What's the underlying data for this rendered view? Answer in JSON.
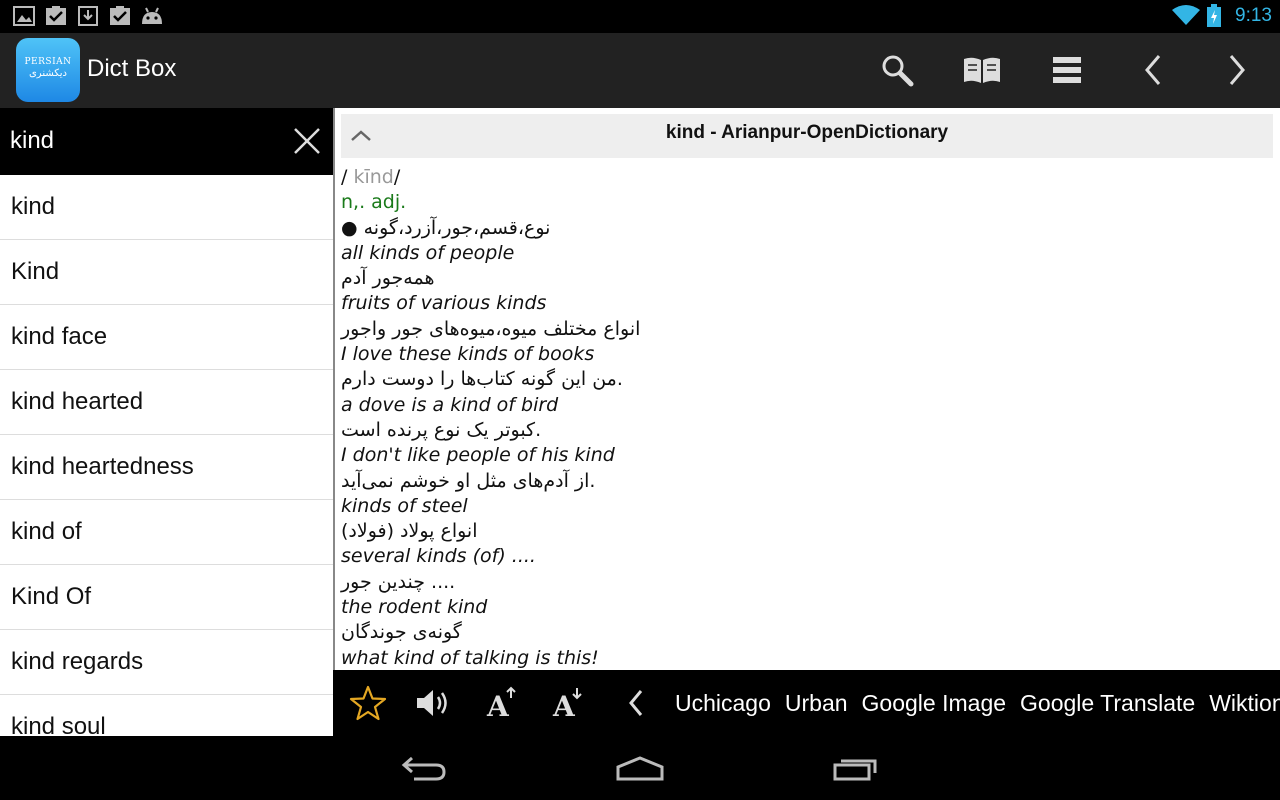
{
  "status_bar": {
    "time": "9:13",
    "left_icons": [
      "image-notification-icon",
      "task-done-icon",
      "download-icon",
      "task-done-icon",
      "android-debug-icon"
    ],
    "right_icons": [
      "wifi-icon",
      "battery-charging-icon"
    ],
    "accent_color": "#33b5e5"
  },
  "action_bar": {
    "app_logo_line1": "PERSIAN",
    "app_logo_line2": "دیکشنری",
    "app_title": "Dict Box",
    "buttons": [
      "search-icon",
      "book-icon",
      "list-icon",
      "chevron-left-icon",
      "chevron-right-icon"
    ]
  },
  "search": {
    "value": "kind"
  },
  "word_list": [
    "kind",
    "Kind",
    "kind face",
    "kind hearted",
    "kind heartedness",
    "kind of",
    "Kind Of",
    "kind regards",
    "kind soul"
  ],
  "definition": {
    "title": "kind - Arianpur-OpenDictionary",
    "pronunciation_open": "/ ",
    "pronunciation": "kīnd",
    "pronunciation_close": "/",
    "part_of_speech": "n,. adj.",
    "meaning": "● نوع،قسم،جور،آزرد،گونه",
    "examples": [
      {
        "en": "all kinds of people",
        "fa": "همه‌جور آدم"
      },
      {
        "en": "fruits of various kinds",
        "fa": "انواع مختلف میوه،میوه‌های جور واجور"
      },
      {
        "en": "I love these kinds of books",
        "fa": "من این گونه کتاب‌ها را دوست دارم."
      },
      {
        "en": "a dove is a kind of bird",
        "fa": "کبوتر یک نوع پرنده است."
      },
      {
        "en": "I don't like people of his kind",
        "fa": "از آدم‌های مثل او خوشم نمی‌آید."
      },
      {
        "en": "kinds of steel",
        "fa": "انواع پولاد (فولاد)"
      },
      {
        "en": "several kinds (of) ....",
        "fa": "چندین جور ...."
      },
      {
        "en": "the rodent kind",
        "fa": "گونه‌ی جوندگان"
      },
      {
        "en": "what kind of talking is this!",
        "fa": ""
      }
    ]
  },
  "bottom_toolbar": {
    "buttons": [
      "star-icon",
      "speaker-icon",
      "font-increase-icon",
      "font-decrease-icon",
      "chevron-left-icon"
    ],
    "star_color": "#e5a823",
    "dict_links": [
      "Uchicago",
      "Urban",
      "Google Image",
      "Google Translate",
      "Wiktionary"
    ]
  },
  "nav_bar": {
    "buttons": [
      "back-icon",
      "home-icon",
      "recent-apps-icon"
    ]
  }
}
